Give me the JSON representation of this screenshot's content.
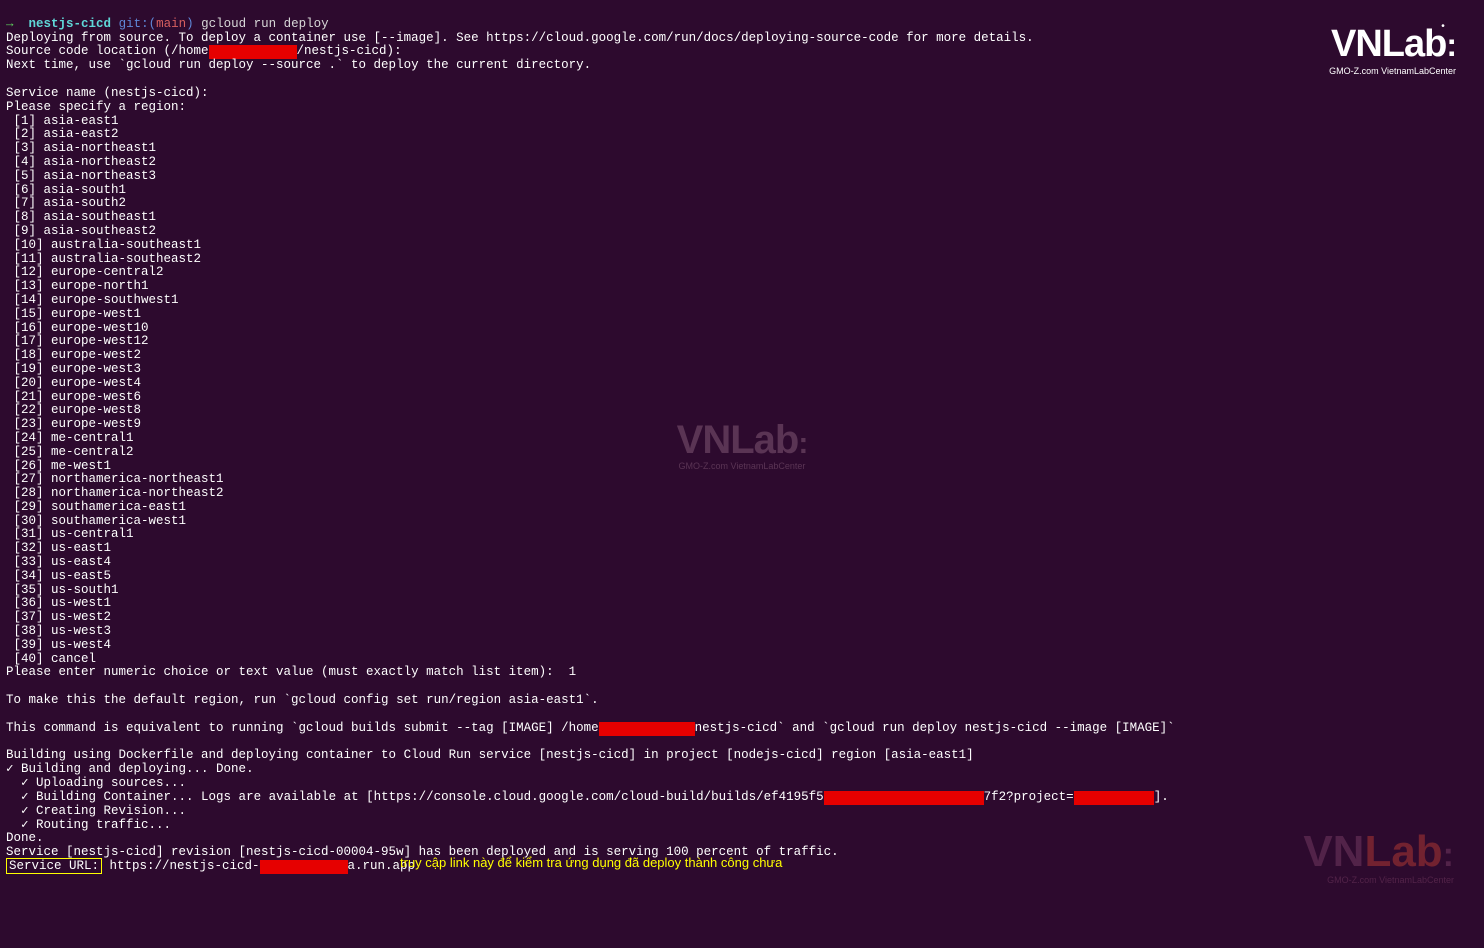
{
  "prompt": {
    "arrow": "→",
    "dir": "nestjs-cicd",
    "git_label": "git:(",
    "git_branch": "main",
    "git_close": ")",
    "command": "gcloud run deploy"
  },
  "lines": {
    "deploy_from_source": "Deploying from source. To deploy a container use [--image]. See https://cloud.google.com/run/docs/deploying-source-code for more details.",
    "source_loc_pre": "Source code location (/home",
    "source_loc_post": "/nestjs-cicd):",
    "next_time": "Next time, use `gcloud run deploy --source .` to deploy the current directory.",
    "service_name": "Service name (nestjs-cicd):",
    "specify_region": "Please specify a region:"
  },
  "regions": [
    " [1] asia-east1",
    " [2] asia-east2",
    " [3] asia-northeast1",
    " [4] asia-northeast2",
    " [5] asia-northeast3",
    " [6] asia-south1",
    " [7] asia-south2",
    " [8] asia-southeast1",
    " [9] asia-southeast2",
    " [10] australia-southeast1",
    " [11] australia-southeast2",
    " [12] europe-central2",
    " [13] europe-north1",
    " [14] europe-southwest1",
    " [15] europe-west1",
    " [16] europe-west10",
    " [17] europe-west12",
    " [18] europe-west2",
    " [19] europe-west3",
    " [20] europe-west4",
    " [21] europe-west6",
    " [22] europe-west8",
    " [23] europe-west9",
    " [24] me-central1",
    " [25] me-central2",
    " [26] me-west1",
    " [27] northamerica-northeast1",
    " [28] northamerica-northeast2",
    " [29] southamerica-east1",
    " [30] southamerica-west1",
    " [31] us-central1",
    " [32] us-east1",
    " [33] us-east4",
    " [34] us-east5",
    " [35] us-south1",
    " [36] us-west1",
    " [37] us-west2",
    " [38] us-west3",
    " [39] us-west4",
    " [40] cancel"
  ],
  "choice_prompt": "Please enter numeric choice or text value (must exactly match list item):  1",
  "default_region": "To make this the default region, run `gcloud config set run/region asia-east1`.",
  "equiv_pre": "This command is equivalent to running `gcloud builds submit --tag [IMAGE] /home",
  "equiv_post": "nestjs-cicd` and `gcloud run deploy nestjs-cicd --image [IMAGE]`",
  "building_line": "Building using Dockerfile and deploying container to Cloud Run service [nestjs-cicd] in project [nodejs-cicd] region [asia-east1]",
  "build_done": "✓ Building and deploying... Done.",
  "uploading": "  ✓ Uploading sources...",
  "build_container_pre": "  ✓ Building Container... Logs are available at [https://console.cloud.google.com/cloud-build/builds/ef4195f5",
  "build_container_mid": "7f2?project=",
  "build_container_post": "].",
  "creating_rev": "  ✓ Creating Revision...",
  "routing": "  ✓ Routing traffic...",
  "done": "Done.",
  "service_deployed": "Service [nestjs-cicd] revision [nestjs-cicd-00004-95w] has been deployed and is serving 100 percent of traffic.",
  "service_url_label": "Service URL:",
  "service_url_pre": " https://nestjs-cicd-",
  "service_url_post": "a.run.app",
  "annotation_text": "truy cập link này để kiểm tra ứng dụng đã deploy thành công chưa",
  "logo": {
    "brand": "VNLab",
    "sub": "GMO-Z.com VietnamLabCenter"
  }
}
